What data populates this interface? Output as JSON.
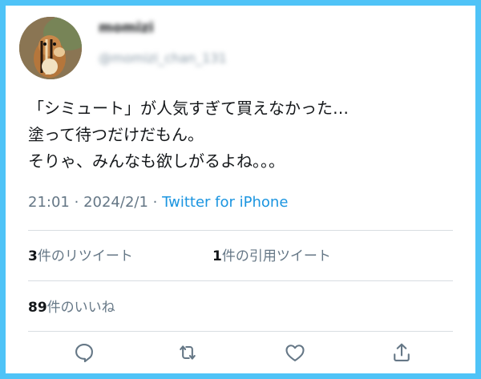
{
  "user": {
    "display_name": "momizi",
    "handle": "@momizi_chan_131",
    "avatar_icon": "chipmunk-avatar-icon"
  },
  "tweet": {
    "lines": [
      "「シミュート」が人気すぎて買えなかった…",
      "塗って待つだけだもん。",
      "そりゃ、みんなも欲しがるよね。。。"
    ],
    "time": "21:01",
    "date": "2024/2/1",
    "separator": "·",
    "source": "Twitter for iPhone"
  },
  "stats": {
    "retweets_count": "3",
    "retweets_label": "件のリツイート",
    "quotes_count": "1",
    "quotes_label": "件の引用ツイート",
    "likes_count": "89",
    "likes_label": "件のいいね"
  },
  "actions": {
    "icons": [
      "reply-icon",
      "retweet-icon",
      "like-icon",
      "share-icon"
    ]
  },
  "colors": {
    "frame": "#4fc3f7",
    "link": "#1b95e0",
    "muted": "#657786",
    "text": "#14171a"
  }
}
